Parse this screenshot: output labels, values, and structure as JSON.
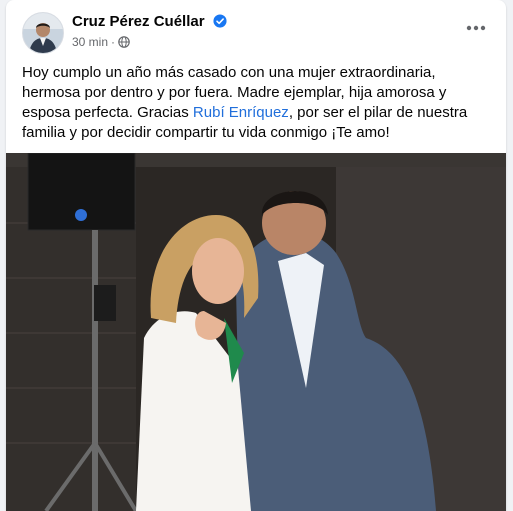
{
  "post": {
    "author": "Cruz Pérez Cuéllar",
    "time": "30 min",
    "separator": "·",
    "text_before": "Hoy cumplo un año más casado con una mujer extraordinaria, hermosa por dentro y por fuera. Madre ejemplar, hija amorosa y esposa perfecta. Gracias ",
    "mention": "Rubí Enríquez",
    "text_after": ", por ser el pilar de nuestra familia y por decidir compartir tu vida conmigo ¡Te amo!"
  },
  "icons": {
    "verified": "verified-badge-icon",
    "audience": "globe-icon",
    "more": "more-options-icon",
    "verified_color": "#1877f2"
  }
}
